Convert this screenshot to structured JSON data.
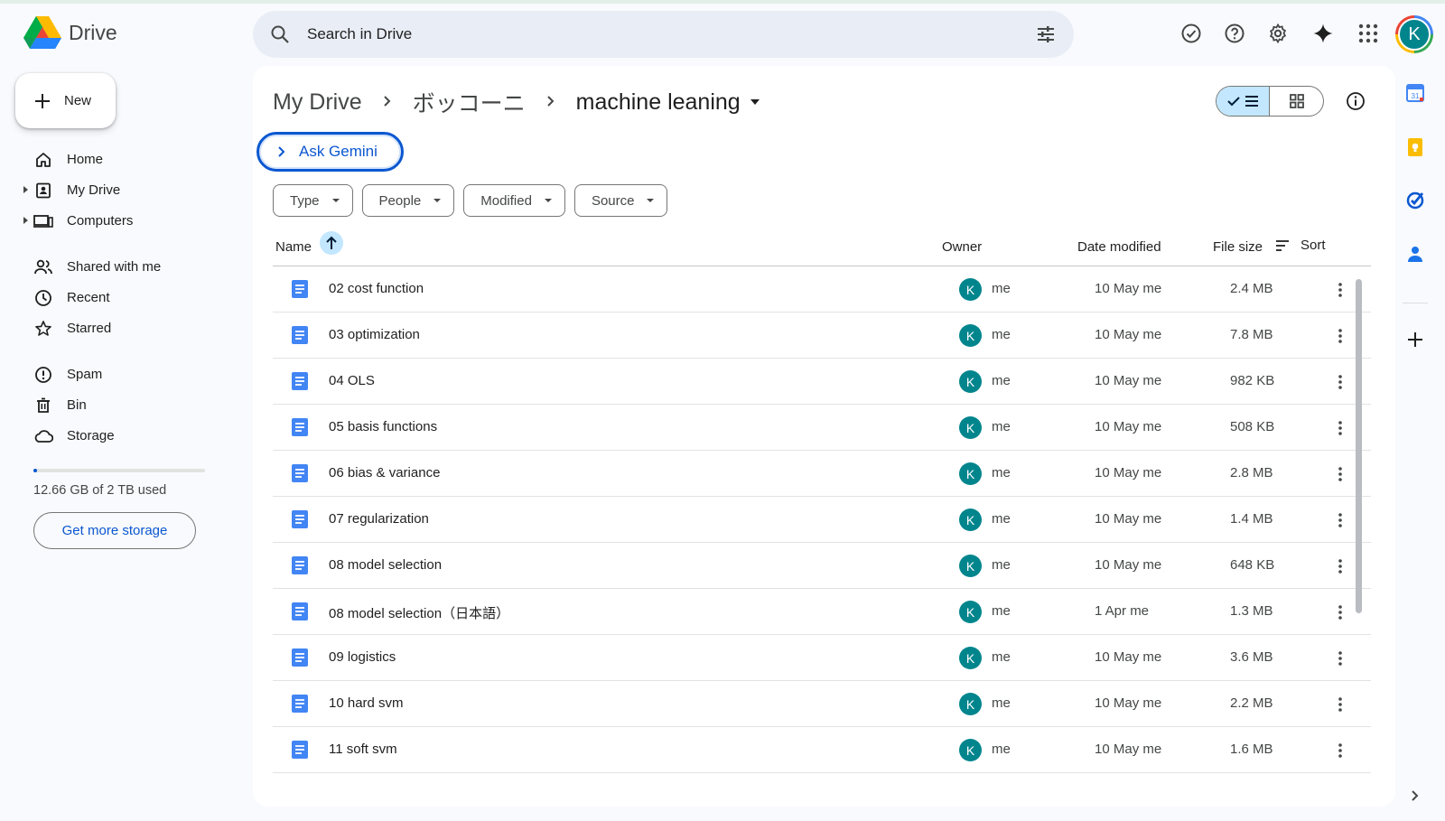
{
  "app": {
    "name": "Drive"
  },
  "search": {
    "placeholder": "Search in Drive"
  },
  "sidebar": {
    "new_label": "New",
    "items": [
      {
        "label": "Home",
        "icon": "home-icon"
      },
      {
        "label": "My Drive",
        "icon": "my-drive-icon"
      },
      {
        "label": "Computers",
        "icon": "computers-icon"
      },
      {
        "label": "Shared with me",
        "icon": "shared-icon"
      },
      {
        "label": "Recent",
        "icon": "clock-icon"
      },
      {
        "label": "Starred",
        "icon": "star-icon"
      },
      {
        "label": "Spam",
        "icon": "spam-icon"
      },
      {
        "label": "Bin",
        "icon": "bin-icon"
      },
      {
        "label": "Storage",
        "icon": "cloud-icon"
      }
    ],
    "storage_text": "12.66 GB of 2 TB used",
    "storage_used_fraction": 0.0063,
    "get_more_storage": "Get more storage"
  },
  "header": {
    "avatar_letter": "K"
  },
  "breadcrumb": {
    "root": "My Drive",
    "parent": "ボッコーニ",
    "current": "machine leaning"
  },
  "ask_gemini": "Ask Gemini",
  "filters": [
    "Type",
    "People",
    "Modified",
    "Source"
  ],
  "table": {
    "columns": {
      "name": "Name",
      "owner": "Owner",
      "modified": "Date modified",
      "size": "File size",
      "sort": "Sort"
    },
    "rows": [
      {
        "name": "02 cost function",
        "owner_letter": "K",
        "owner": "me",
        "modified": "10 May me",
        "size": "2.4 MB"
      },
      {
        "name": "03 optimization",
        "owner_letter": "K",
        "owner": "me",
        "modified": "10 May me",
        "size": "7.8 MB"
      },
      {
        "name": "04 OLS",
        "owner_letter": "K",
        "owner": "me",
        "modified": "10 May me",
        "size": "982 KB"
      },
      {
        "name": "05 basis functions",
        "owner_letter": "K",
        "owner": "me",
        "modified": "10 May me",
        "size": "508 KB"
      },
      {
        "name": "06 bias & variance",
        "owner_letter": "K",
        "owner": "me",
        "modified": "10 May me",
        "size": "2.8 MB"
      },
      {
        "name": "07 regularization",
        "owner_letter": "K",
        "owner": "me",
        "modified": "10 May me",
        "size": "1.4 MB"
      },
      {
        "name": "08 model selection",
        "owner_letter": "K",
        "owner": "me",
        "modified": "10 May me",
        "size": "648 KB"
      },
      {
        "name": "08 model selection（日本語）",
        "owner_letter": "K",
        "owner": "me",
        "modified": "1 Apr me",
        "size": "1.3 MB"
      },
      {
        "name": "09 logistics",
        "owner_letter": "K",
        "owner": "me",
        "modified": "10 May me",
        "size": "3.6 MB"
      },
      {
        "name": "10 hard svm",
        "owner_letter": "K",
        "owner": "me",
        "modified": "10 May me",
        "size": "2.2 MB"
      },
      {
        "name": "11 soft svm",
        "owner_letter": "K",
        "owner": "me",
        "modified": "10 May me",
        "size": "1.6 MB"
      }
    ]
  },
  "colors": {
    "accent": "#0b57d0",
    "avatar": "#01858d",
    "doc": "#4285f4",
    "selected": "#c2e7ff"
  }
}
